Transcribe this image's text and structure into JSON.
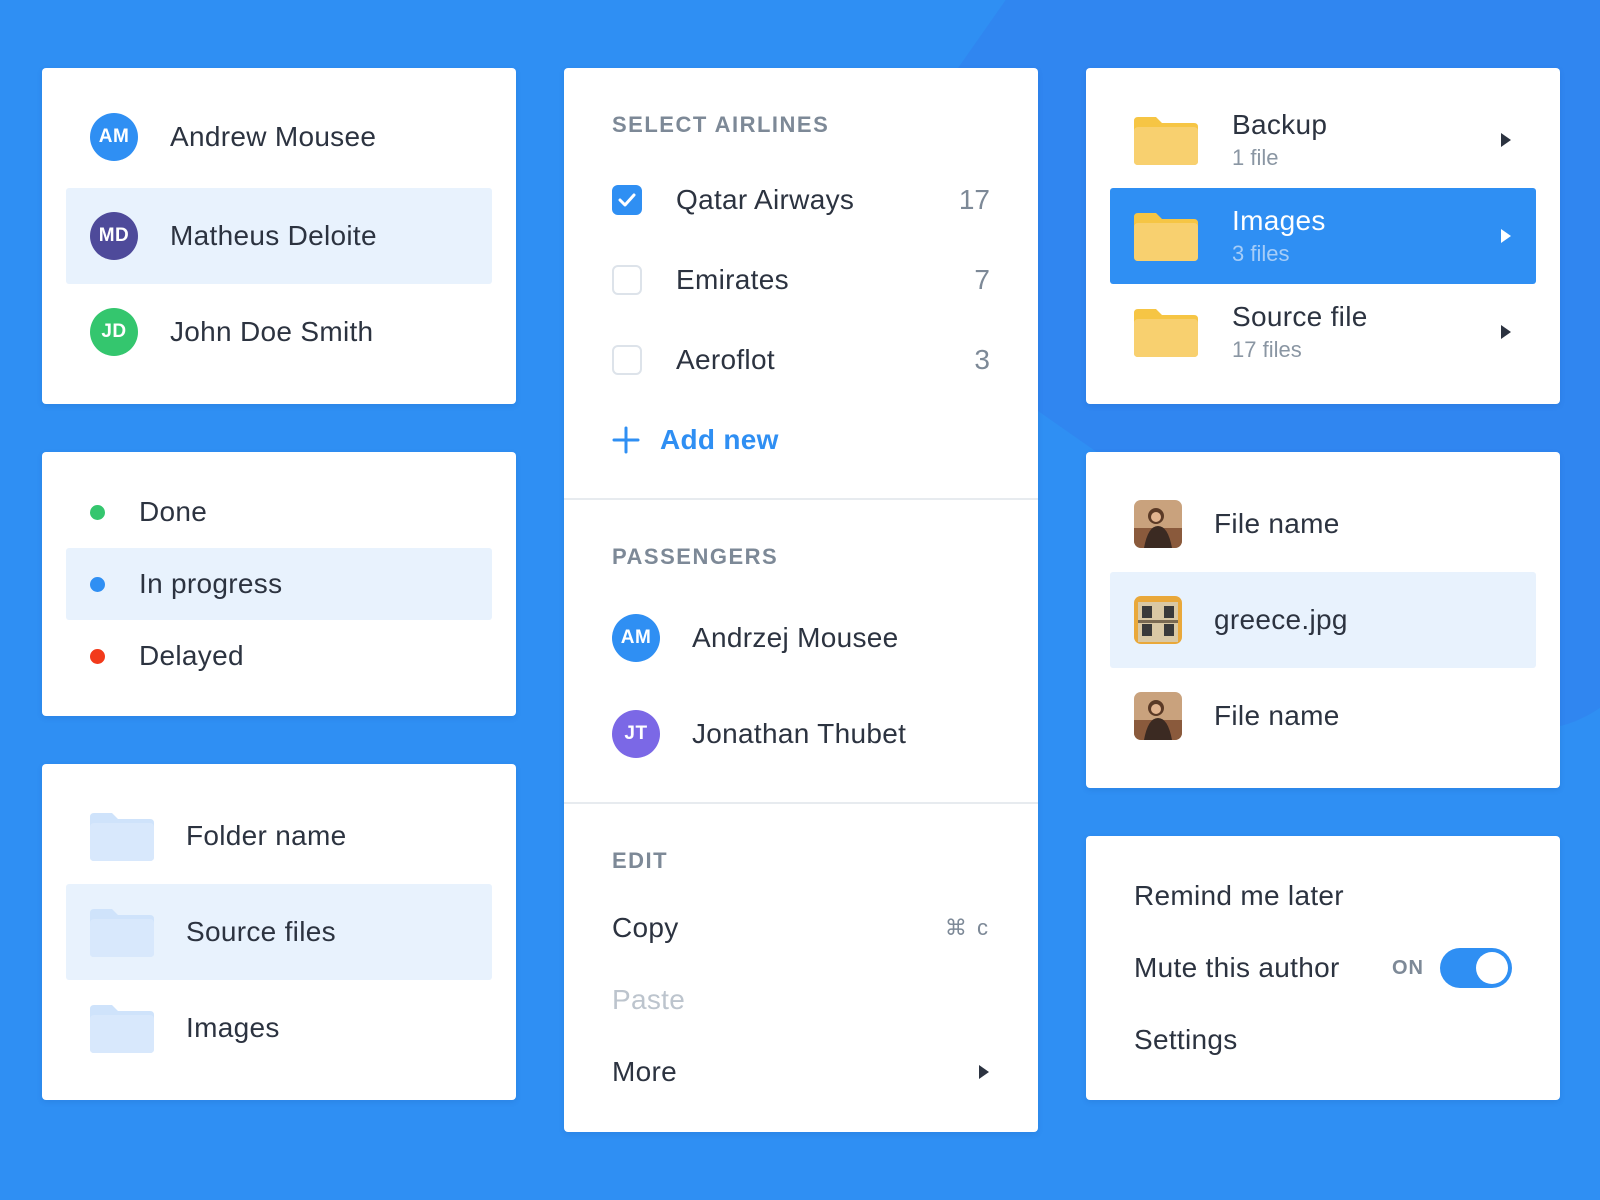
{
  "colors": {
    "background": "#2f8ff3",
    "selected_row": "#e8f2fd",
    "accent": "#2f8ff3",
    "status_done": "#34c66e",
    "status_in_progress": "#2f8ff3",
    "status_delayed": "#f23a1b"
  },
  "contacts": {
    "items": [
      {
        "initials": "AM",
        "name": "Andrew Mousee",
        "color": "#2f8ff3",
        "selected": false
      },
      {
        "initials": "MD",
        "name": "Matheus Deloite",
        "color": "#4e4a9a",
        "selected": true
      },
      {
        "initials": "JD",
        "name": "John Doe Smith",
        "color": "#34c66e",
        "selected": false
      }
    ]
  },
  "status": {
    "items": [
      {
        "label": "Done",
        "color": "#34c66e",
        "selected": false
      },
      {
        "label": "In progress",
        "color": "#2f8ff3",
        "selected": true
      },
      {
        "label": "Delayed",
        "color": "#f23a1b",
        "selected": false
      }
    ]
  },
  "folders": {
    "items": [
      {
        "label": "Folder name",
        "icon": "folder-icon",
        "selected": false
      },
      {
        "label": "Source files",
        "icon": "folder-icon",
        "selected": true
      },
      {
        "label": "Images",
        "icon": "folder-icon",
        "selected": false
      }
    ]
  },
  "airlines": {
    "title": "SELECT AIRLINES",
    "items": [
      {
        "name": "Qatar Airways",
        "count": "17",
        "checked": true
      },
      {
        "name": "Emirates",
        "count": "7",
        "checked": false
      },
      {
        "name": "Aeroflot",
        "count": "3",
        "checked": false
      }
    ],
    "add_new": "Add new"
  },
  "passengers": {
    "title": "PASSENGERS",
    "items": [
      {
        "initials": "AM",
        "name": "Andrzej Mousee",
        "color": "#2f8ff3"
      },
      {
        "initials": "JT",
        "name": "Jonathan Thubet",
        "color": "#7b68e6"
      }
    ]
  },
  "edit": {
    "title": "EDIT",
    "copy": "Copy",
    "copy_shortcut": "⌘ c",
    "paste": "Paste",
    "more": "More"
  },
  "directories": {
    "items": [
      {
        "name": "Backup",
        "meta": "1 file",
        "selected": false
      },
      {
        "name": "Images",
        "meta": "3 files",
        "selected": true
      },
      {
        "name": "Source file",
        "meta": "17 files",
        "selected": false
      }
    ]
  },
  "files": {
    "items": [
      {
        "name": "File name",
        "thumb": "portrait-thumbnail",
        "selected": false
      },
      {
        "name": "greece.jpg",
        "thumb": "building-thumbnail",
        "selected": true
      },
      {
        "name": "File name",
        "thumb": "portrait-thumbnail",
        "selected": false
      }
    ]
  },
  "settings_menu": {
    "remind": "Remind me later",
    "mute": "Mute this author",
    "toggle_state": "ON",
    "toggle_on": true,
    "settings": "Settings"
  }
}
